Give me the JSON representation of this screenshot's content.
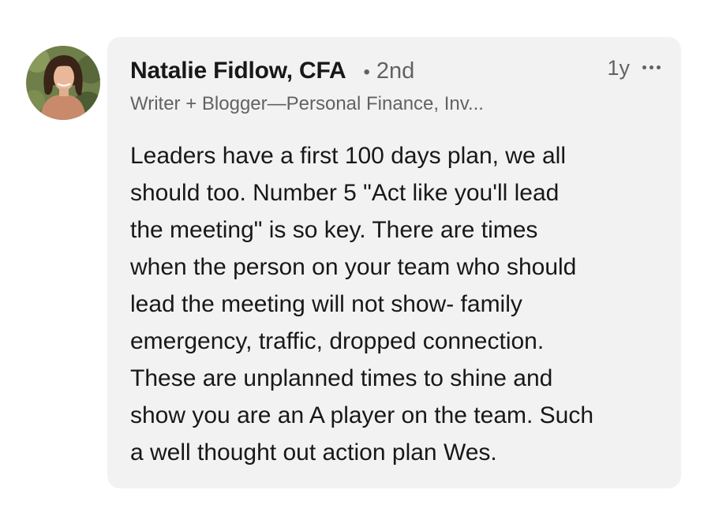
{
  "comment": {
    "author": {
      "name": "Natalie Fidlow, CFA",
      "degree_separator": "•",
      "degree": "2nd",
      "headline": "Writer + Blogger—Personal Finance, Inv..."
    },
    "timestamp": "1y",
    "more_icon": "ellipsis-icon",
    "text_lines": [
      "Leaders have a first 100 days plan, we all",
      "should too. Number 5 \"Act like you'll lead",
      "the meeting\" is so key. There are times",
      "when the person on your team who should",
      "lead the meeting will not show- family",
      "emergency, traffic, dropped connection.",
      "These are unplanned times to shine and",
      "show you are an A player on the team. Such",
      "a well thought out action plan Wes."
    ]
  },
  "colors": {
    "bubble_background": "#f2f2f2",
    "primary_text": "#1a1a1a",
    "secondary_text": "#666666"
  }
}
